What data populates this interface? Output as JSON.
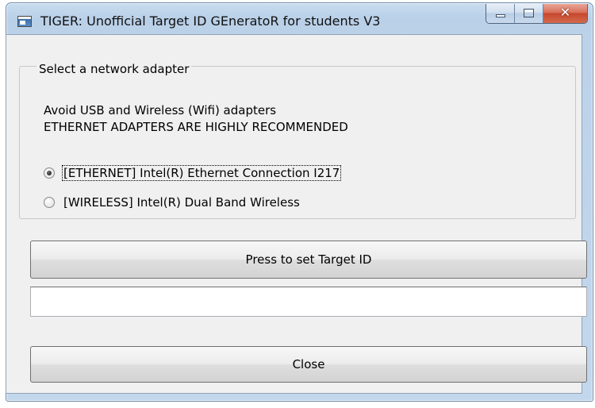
{
  "window": {
    "title": "TIGER: Unofficial Target ID GEneratoR for students V3",
    "icon": "app-window-icon",
    "caption_buttons": {
      "minimize": "minimize-icon",
      "maximize": "maximize-icon",
      "close": "close-icon",
      "close_glyph": "✕"
    }
  },
  "group": {
    "legend": "Select a network adapter",
    "info_lines": [
      "Avoid USB and Wireless (Wifi) adapters",
      "ETHERNET ADAPTERS ARE HIGHLY RECOMMENDED"
    ],
    "adapters": [
      {
        "label": "[ETHERNET] Intel(R) Ethernet Connection I217",
        "checked": true
      },
      {
        "label": "[WIRELESS] Intel(R) Dual Band Wireless",
        "checked": false
      }
    ]
  },
  "actions": {
    "set_target_label": "Press to set Target ID",
    "target_id_value": "",
    "close_label": "Close"
  },
  "colors": {
    "title_glass": "#bcd2e9",
    "client_bg": "#f0f0f0",
    "close_red": "#c6472d"
  }
}
